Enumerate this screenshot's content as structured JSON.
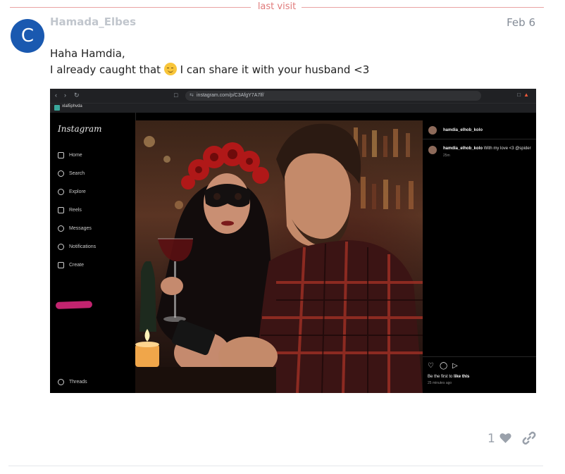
{
  "divider": {
    "label": "last visit"
  },
  "post": {
    "avatar_letter": "C",
    "username": "Hamada_Elbes",
    "date": "Feb 6",
    "lines": [
      "Haha Hamdia,",
      "I already caught that",
      "I can share it with your husband <3"
    ],
    "like_count": "1"
  },
  "screenshot": {
    "url": "instagram.com/p/C3AfgY7A7lf/",
    "bookmark": "xlal5phvda",
    "ig_logo": "Instagram",
    "nav": [
      "Home",
      "Search",
      "Explore",
      "Reels",
      "Messages",
      "Notifications",
      "Create",
      "Threads"
    ],
    "post_user": "hamdia_elhob_kolo",
    "comment_user": "hamdia_elhob_kolo",
    "comment_text": "With my love <3 @spider",
    "comment_time": "25m",
    "likes_prefix": "Be the first to",
    "likes_bold": "like this",
    "time_ago": "25 minutes ago"
  },
  "colors": {
    "avatar": "#1a59b0",
    "divider": "#e07a7a",
    "scribble": "#c2246f"
  }
}
